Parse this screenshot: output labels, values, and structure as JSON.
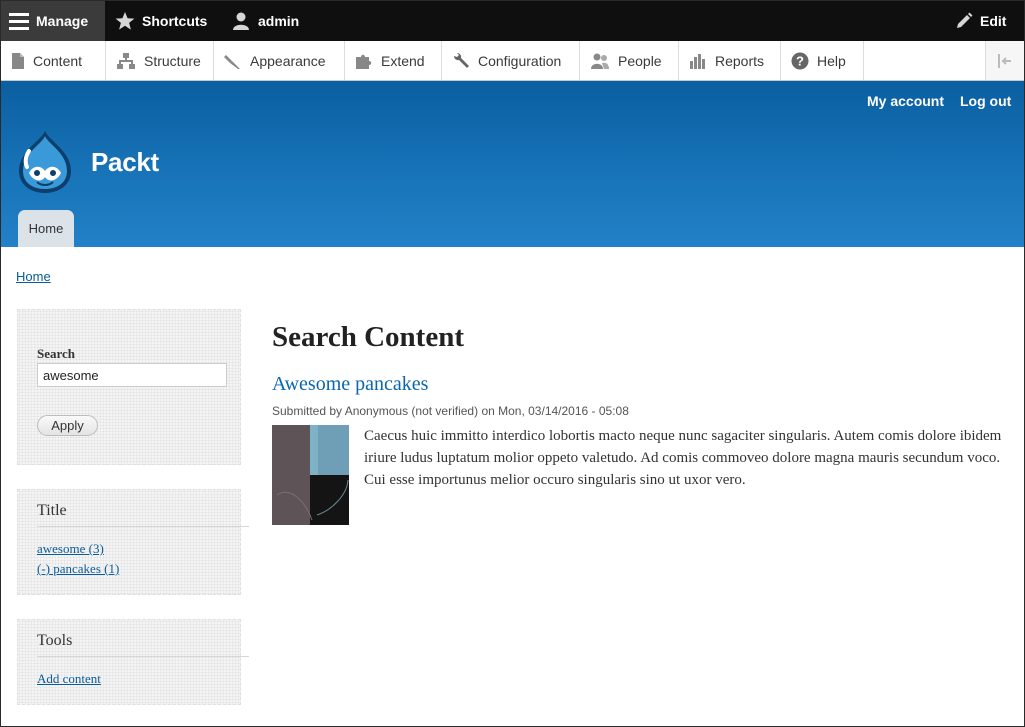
{
  "toolbar": {
    "manage": "Manage",
    "shortcuts": "Shortcuts",
    "user": "admin",
    "edit": "Edit"
  },
  "tray": {
    "items": [
      {
        "label": "Content",
        "icon": "page-icon"
      },
      {
        "label": "Structure",
        "icon": "sitemap-icon"
      },
      {
        "label": "Appearance",
        "icon": "brush-icon"
      },
      {
        "label": "Extend",
        "icon": "puzzle-icon"
      },
      {
        "label": "Configuration",
        "icon": "wrench-icon"
      },
      {
        "label": "People",
        "icon": "people-icon"
      },
      {
        "label": "Reports",
        "icon": "bar-chart-icon"
      },
      {
        "label": "Help",
        "icon": "help-icon"
      }
    ]
  },
  "header": {
    "site_name": "Packt",
    "my_account": "My account",
    "log_out": "Log out",
    "tab_home": "Home"
  },
  "breadcrumb": {
    "home": "Home"
  },
  "sidebar": {
    "search": {
      "label": "Search",
      "value": "awesome",
      "apply": "Apply"
    },
    "title_block": {
      "heading": "Title",
      "facets": [
        "awesome (3)",
        "(-) pancakes (1)"
      ]
    },
    "tools_block": {
      "heading": "Tools",
      "link": "Add content"
    }
  },
  "main": {
    "title": "Search Content",
    "result": {
      "title": "Awesome pancakes",
      "submitted": "Submitted by Anonymous (not verified) on Mon, 03/14/2016 - 05:08",
      "snippet": "Caecus huic immitto interdico lobortis macto neque nunc sagaciter singularis. Autem comis dolore ibidem iriure ludus luptatum molior oppeto valetudo. Ad comis commoveo dolore magna mauris secundum voco. Cui esse importunus melior occuro singularis sino ut uxor vero."
    }
  },
  "colors": {
    "header_blue": "#0a5fa0",
    "link_blue": "#0a5c9a",
    "toolbar_black": "#0f0f0f"
  }
}
